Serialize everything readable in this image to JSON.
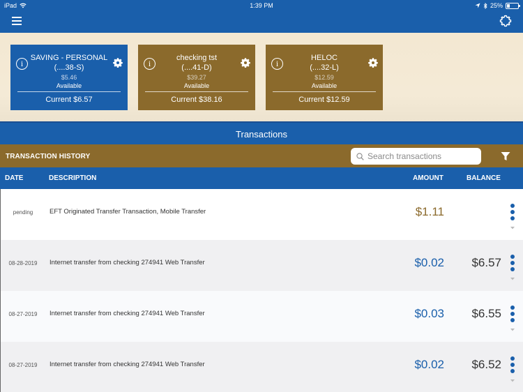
{
  "status_bar": {
    "device": "iPad",
    "time": "1:39 PM",
    "battery": "25%",
    "battery_level": 0.25
  },
  "header": {
    "menu_icon": "hamburger-menu-icon",
    "settings_icon": "gear-icon"
  },
  "accounts": [
    {
      "name": "SAVING - PERSONAL",
      "number": "(....38-S)",
      "available_amount": "$5.46",
      "available_label": "Available",
      "current": "Current $6.57",
      "color": "#1a5fab",
      "selected": true
    },
    {
      "name": "checking tst",
      "number": "(....41-D)",
      "available_amount": "$39.27",
      "available_label": "Available",
      "current": "Current $38.16",
      "color": "#8b6a2c",
      "selected": false
    },
    {
      "name": "HELOC",
      "number": "(....32-L)",
      "available_amount": "$12.59",
      "available_label": "Available",
      "current": "Current $12.59",
      "color": "#8b6a2c",
      "selected": false
    }
  ],
  "transactions": {
    "title": "Transactions",
    "history_label": "TRANSACTION HISTORY",
    "search_placeholder": "Search transactions",
    "search_value": "",
    "columns": {
      "date": "DATE",
      "description": "DESCRIPTION",
      "amount": "AMOUNT",
      "balance": "BALANCE"
    },
    "rows": [
      {
        "date": "pending",
        "description": "EFT Originated Transfer Transaction, Mobile Transfer",
        "amount": "$1.11",
        "balance": "",
        "status": "pending"
      },
      {
        "date": "08-28-2019",
        "description": "Internet transfer from checking 274941 Web Transfer",
        "amount": "$0.02",
        "balance": "$6.57",
        "status": "posted"
      },
      {
        "date": "08-27-2019",
        "description": "Internet transfer from checking 274941 Web Transfer",
        "amount": "$0.03",
        "balance": "$6.55",
        "status": "posted"
      },
      {
        "date": "08-27-2019",
        "description": "Internet transfer from checking 274941 Web Transfer",
        "amount": "$0.02",
        "balance": "$6.52",
        "status": "posted"
      }
    ]
  },
  "colors": {
    "primary_blue": "#1a5fab",
    "gold": "#8b6a2c",
    "background_cream": "#f3e8d2"
  }
}
